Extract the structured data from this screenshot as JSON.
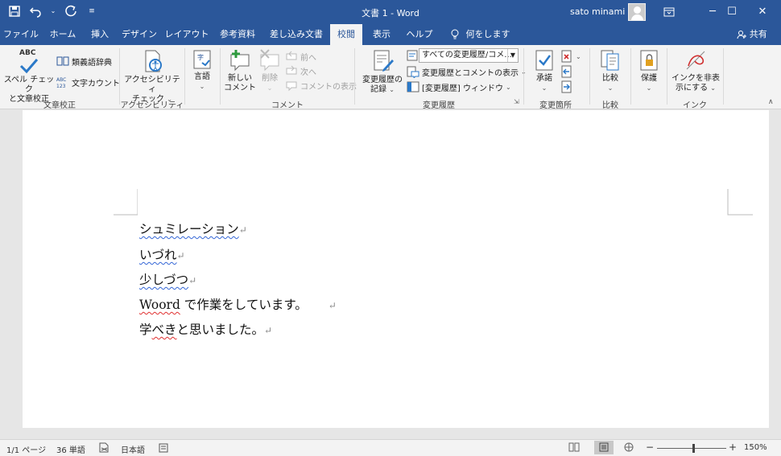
{
  "titlebar": {
    "doc_title": "文書 1 - Word",
    "user_name": "sato minami",
    "qat": {
      "save_icon": "save-icon",
      "undo_icon": "undo-icon",
      "redo_icon": "redo-icon",
      "customize_icon": "customize-qat-icon"
    }
  },
  "tabs": [
    "ファイル",
    "ホーム",
    "挿入",
    "デザイン",
    "レイアウト",
    "参考資料",
    "差し込み文書",
    "校閲",
    "表示",
    "ヘルプ",
    "何をしますか"
  ],
  "active_tab": "校閲",
  "share_label": "共有",
  "ribbon": {
    "proofing": {
      "spell_label_1": "スペル チェック",
      "spell_label_2": "と文章校正",
      "thesaurus": "類義語辞典",
      "word_count": "文字カウント",
      "abc": "ABC",
      "group": "文章校正"
    },
    "accessibility": {
      "label_1": "アクセシビリティ",
      "label_2": "チェック",
      "group": "アクセシビリティ"
    },
    "language": {
      "label": "言語"
    },
    "comments": {
      "new_1": "新しい",
      "new_2": "コメント",
      "delete": "削除",
      "prev": "前へ",
      "next": "次へ",
      "show": "コメントの表示",
      "group": "コメント"
    },
    "tracking": {
      "track_1": "変更履歴の",
      "track_2": "記録",
      "markup_select": "すべての変更履歴/コメ...",
      "show_markup": "変更履歴とコメントの表示",
      "pane": "[変更履歴] ウィンドウ",
      "group": "変更履歴"
    },
    "changes": {
      "accept": "承諾",
      "group": "変更箇所"
    },
    "compare": {
      "label": "比較",
      "group": "比較"
    },
    "protect": {
      "label": "保護"
    },
    "ink": {
      "label_1": "インクを非表",
      "label_2": "示にする",
      "group": "インク"
    }
  },
  "document": {
    "lines": [
      "シュミレーション",
      "いづれ",
      "少しづつ",
      "Woord で作業をしています。",
      "学べきと思いました。"
    ],
    "line4_word": "Woord",
    "line4_rest": " で作業をしています。",
    "line5_a": "学",
    "line5_b": "べき",
    "line5_c": "と思いました。",
    "para_mark": "↵"
  },
  "statusbar": {
    "page": "1/1 ページ",
    "words": "36 単語",
    "language": "日本語",
    "zoom": "150%",
    "zoom_minus": "−",
    "zoom_plus": "+"
  },
  "colors": {
    "titlebar": "#2b579a",
    "ribbon": "#f3f3f3",
    "accent": "#2b579a"
  }
}
